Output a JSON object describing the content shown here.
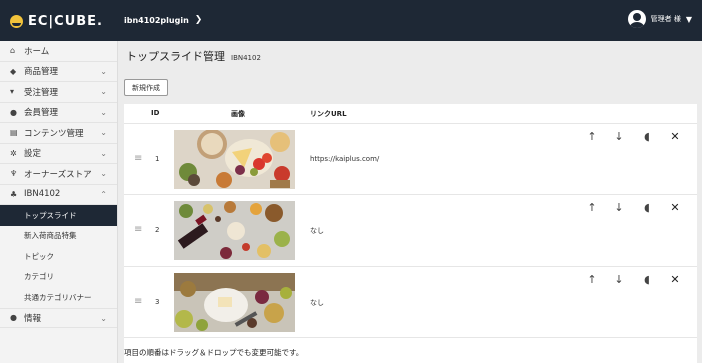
{
  "header": {
    "logo_text": "EC|CUBE.",
    "breadcrumb": "ibn4102plugin",
    "user_label": "管理者 様"
  },
  "sidebar": {
    "items": [
      {
        "label": "ホーム",
        "icon": "home-icon"
      },
      {
        "label": "商品管理",
        "icon": "tag-icon"
      },
      {
        "label": "受注管理",
        "icon": "cart-icon"
      },
      {
        "label": "会員管理",
        "icon": "users-icon"
      },
      {
        "label": "コンテンツ管理",
        "icon": "file-icon"
      },
      {
        "label": "設定",
        "icon": "gear-icon"
      },
      {
        "label": "オーナーズストア",
        "icon": "plug-icon"
      },
      {
        "label": "IBN4102",
        "icon": "puzzle-icon"
      }
    ],
    "subitems": [
      {
        "label": "トップスライド",
        "active": true
      },
      {
        "label": "新入荷商品特集"
      },
      {
        "label": "トピック"
      },
      {
        "label": "カテゴリ"
      },
      {
        "label": "共通カテゴリバナー"
      }
    ],
    "info": {
      "label": "情報",
      "icon": "info-icon"
    }
  },
  "page": {
    "title": "トップスライド管理",
    "code": "IBN4102",
    "new_button": "新規作成"
  },
  "table": {
    "headers": {
      "id": "ID",
      "image": "画像",
      "link": "リンクURL"
    },
    "rows": [
      {
        "id": "1",
        "link": "https://kaiplus.com/"
      },
      {
        "id": "2",
        "link": "なし"
      },
      {
        "id": "3",
        "link": "なし"
      }
    ]
  },
  "footer_note": "項目の順番はドラッグ＆ドロップでも変更可能です。"
}
